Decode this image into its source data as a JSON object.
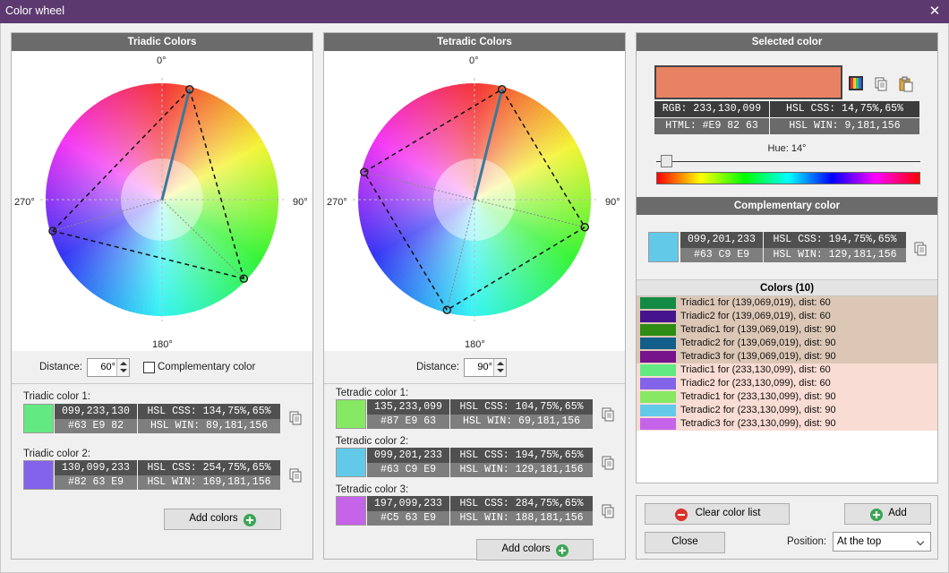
{
  "window": {
    "title": "Color wheel"
  },
  "triadic": {
    "header": "Triadic Colors",
    "angles": {
      "top": "0°",
      "right": "90°",
      "bottom": "180°",
      "left": "270°"
    },
    "distance_label": "Distance:",
    "distance_value": "60°",
    "complementary_label": "Complementary color",
    "colors": [
      {
        "label": "Triadic color 1:",
        "swatch": "#63E982",
        "rgb": "099,233,130",
        "hex": "#63 E9 82",
        "hsl_css": "HSL CSS: 134,75%,65%",
        "hsl_win": "HSL WIN: 89,181,156"
      },
      {
        "label": "Triadic color 2:",
        "swatch": "#8263E9",
        "rgb": "130,099,233",
        "hex": "#82 63 E9",
        "hsl_css": "HSL CSS: 254,75%,65%",
        "hsl_win": "HSL WIN: 169,181,156"
      }
    ],
    "add_label": "Add colors"
  },
  "tetradic": {
    "header": "Tetradic Colors",
    "angles": {
      "top": "0°",
      "right": "90°",
      "bottom": "180°",
      "left": "270°"
    },
    "distance_label": "Distance:",
    "distance_value": "90°",
    "colors": [
      {
        "label": "Tetradic color 1:",
        "swatch": "#87E963",
        "rgb": "135,233,099",
        "hex": "#87 E9 63",
        "hsl_css": "HSL CSS: 104,75%,65%",
        "hsl_win": "HSL WIN: 69,181,156"
      },
      {
        "label": "Tetradic color 2:",
        "swatch": "#63C9E9",
        "rgb": "099,201,233",
        "hex": "#63 C9 E9",
        "hsl_css": "HSL CSS: 194,75%,65%",
        "hsl_win": "HSL WIN: 129,181,156"
      },
      {
        "label": "Tetradic color 3:",
        "swatch": "#C563E9",
        "rgb": "197,099,233",
        "hex": "#C5 63 E9",
        "hsl_css": "HSL CSS: 284,75%,65%",
        "hsl_win": "HSL WIN: 188,181,156"
      }
    ],
    "add_label": "Add colors"
  },
  "selected": {
    "header": "Selected color",
    "swatch": "#E98263",
    "rgb": "RGB: 233,130,099",
    "hsl_css": "HSL CSS: 14,75%,65%",
    "html": "HTML: #E9 82 63",
    "hsl_win": "HSL WIN: 9,181,156",
    "hue_label": "Hue: 14°",
    "hue_value": 14
  },
  "complementary": {
    "header": "Complementary color",
    "swatch": "#63C9E9",
    "rgb": "099,201,233",
    "hex": "#63 C9 E9",
    "hsl_css": "HSL CSS: 194,75%,65%",
    "hsl_win": "HSL WIN: 129,181,156"
  },
  "list": {
    "header": "Colors (10)",
    "items": [
      {
        "swatch": "#138B45",
        "text": "Triadic1 for (139,069,019), dist: 60",
        "group": "#dcc7b6"
      },
      {
        "swatch": "#45138B",
        "text": "Triadic2 for (139,069,019), dist: 60",
        "group": "#dcc7b6"
      },
      {
        "swatch": "#2E8B13",
        "text": "Tetradic1 for (139,069,019), dist: 90",
        "group": "#dcc7b6"
      },
      {
        "swatch": "#135F8B",
        "text": "Tetradic2 for (139,069,019), dist: 90",
        "group": "#dcc7b6"
      },
      {
        "swatch": "#77138B",
        "text": "Tetradic3 for (139,069,019), dist: 90",
        "group": "#dcc7b6"
      },
      {
        "swatch": "#63E982",
        "text": "Triadic1 for (233,130,099), dist: 60",
        "group": "#f9dcd3"
      },
      {
        "swatch": "#8263E9",
        "text": "Triadic2 for (233,130,099), dist: 60",
        "group": "#f9dcd3"
      },
      {
        "swatch": "#87E963",
        "text": "Tetradic1 for (233,130,099), dist: 90",
        "group": "#f9dcd3"
      },
      {
        "swatch": "#63C9E9",
        "text": "Tetradic2 for (233,130,099), dist: 90",
        "group": "#f9dcd3"
      },
      {
        "swatch": "#C563E9",
        "text": "Tetradic3 for (233,130,099), dist: 90",
        "group": "#f9dcd3"
      }
    ]
  },
  "actions": {
    "clear_label": "Clear color list",
    "add_label": "Add",
    "close_label": "Close",
    "position_label": "Position:",
    "position_value": "At the top"
  }
}
